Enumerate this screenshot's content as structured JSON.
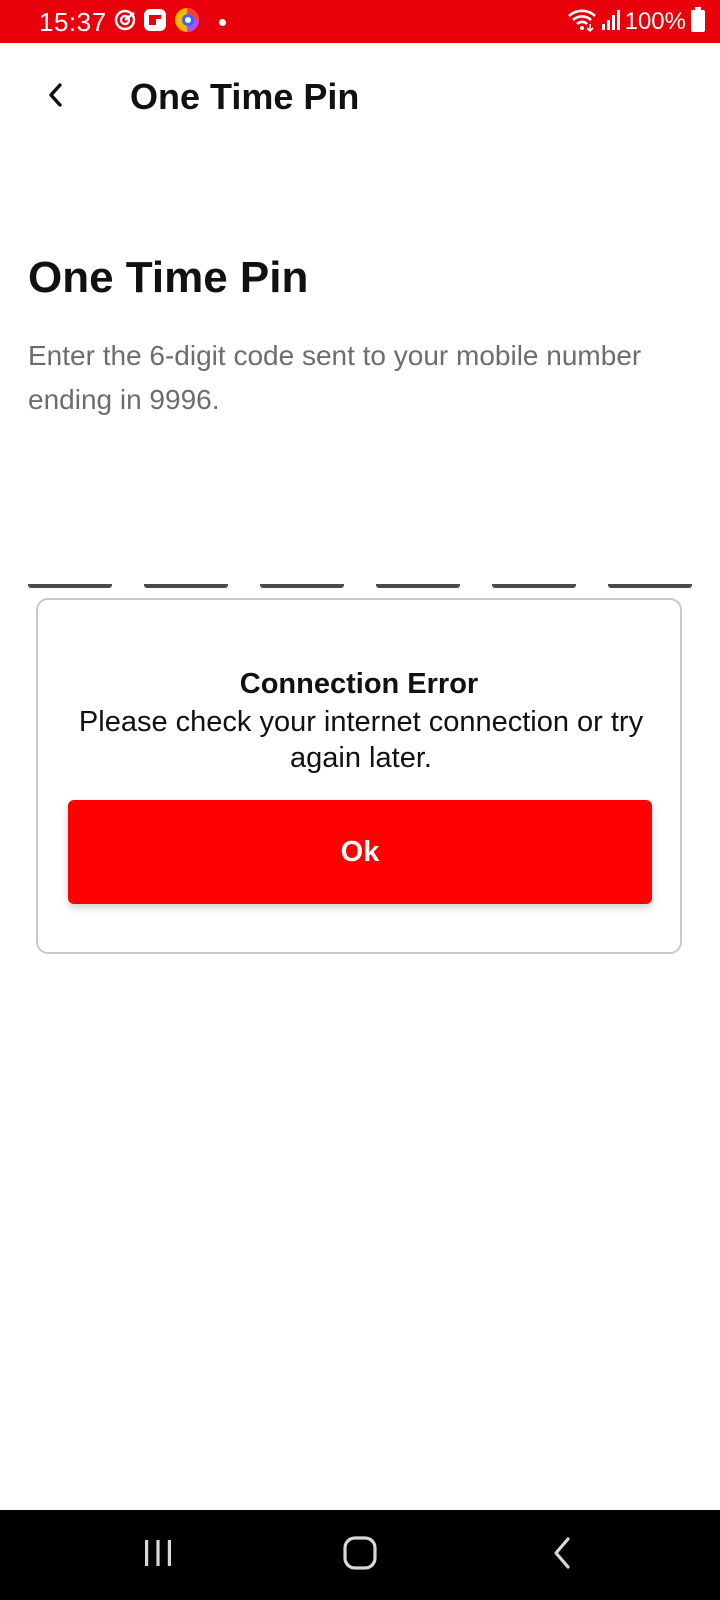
{
  "status_bar": {
    "time": "15:37",
    "battery_text": "100%",
    "background_color": "#e8000a",
    "icons_left": [
      "target-icon",
      "flipboard-icon",
      "browser-icon",
      "notification-dot"
    ],
    "icons_right": [
      "wifi-icon",
      "signal-icon",
      "battery-icon"
    ]
  },
  "app_bar": {
    "title": "One Time Pin",
    "back_icon": "chevron-left-icon"
  },
  "main": {
    "heading": "One Time Pin",
    "instruction": "Enter the 6-digit code sent to your mobile number ending in 9996.",
    "otp_digits": [
      "",
      "",
      "",
      "",
      "",
      ""
    ]
  },
  "dialog": {
    "title": "Connection Error",
    "message": "Please check your internet connection or try again later.",
    "ok_label": "Ok",
    "button_color": "#ff0000"
  },
  "nav_bar": {
    "recents_icon": "recents-icon",
    "home_icon": "home-icon",
    "back_icon": "back-icon"
  }
}
